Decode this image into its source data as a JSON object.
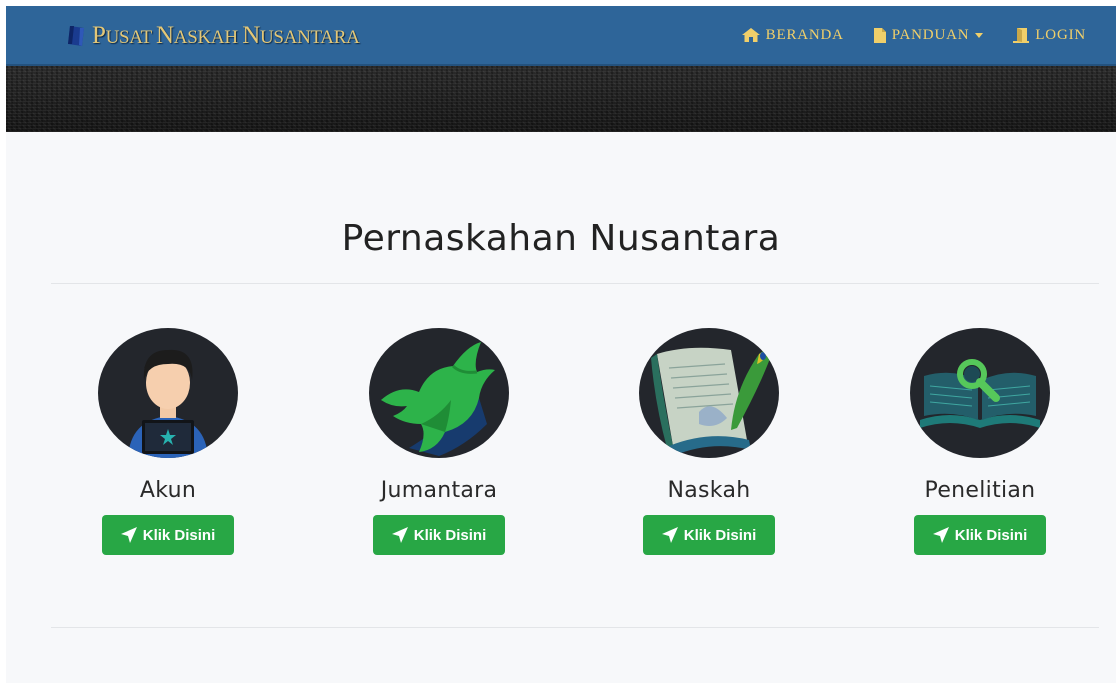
{
  "navbar": {
    "brand": "Pusat Naskah Nusantara",
    "items": [
      {
        "label": "BERANDA",
        "icon": "home-icon"
      },
      {
        "label": "PANDUAN",
        "icon": "file-icon",
        "dropdown": true
      },
      {
        "label": "LOGIN",
        "icon": "door-icon"
      }
    ]
  },
  "main": {
    "title": "Pernaskahan Nusantara",
    "cards": [
      {
        "label": "Akun",
        "button": "Klik Disini",
        "icon": "user-laptop-icon"
      },
      {
        "label": "Jumantara",
        "button": "Klik Disini",
        "icon": "green-bird-icon"
      },
      {
        "label": "Naskah",
        "button": "Klik Disini",
        "icon": "manuscript-quill-icon"
      },
      {
        "label": "Penelitian",
        "button": "Klik Disini",
        "icon": "book-magnifier-icon"
      }
    ]
  },
  "colors": {
    "navbar": "#2e6599",
    "brand_text": "#e3c777",
    "nav_text": "#f0cf6a",
    "button": "#28a745",
    "circle": "#23262c"
  }
}
